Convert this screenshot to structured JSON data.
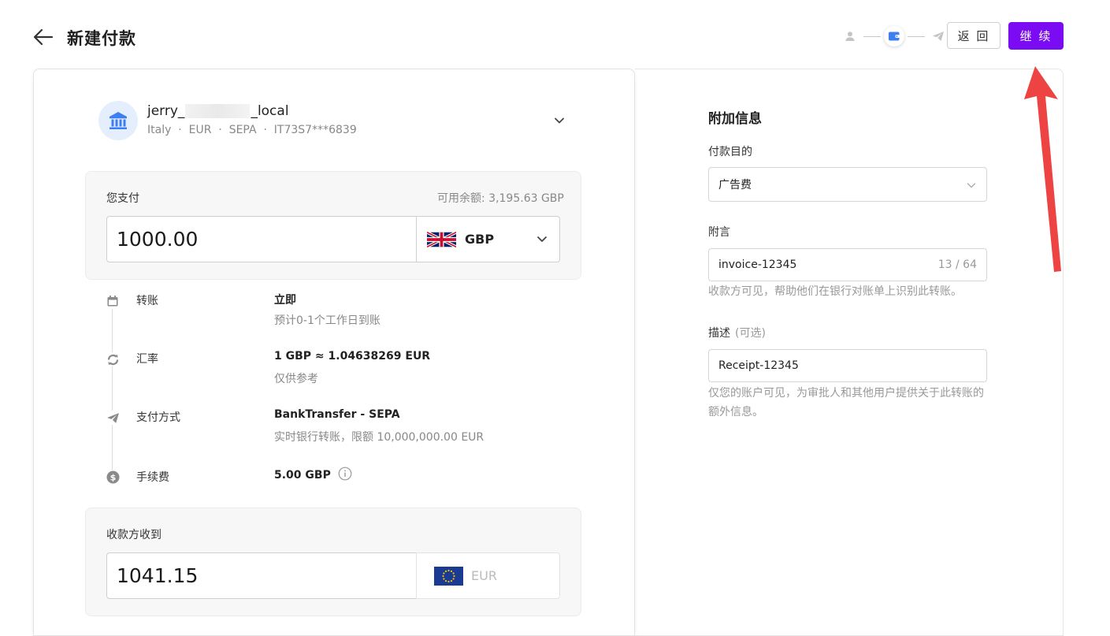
{
  "header": {
    "title": "新建付款",
    "back_button": "返 回",
    "continue_button": "继 续"
  },
  "stepper": {
    "steps": [
      "user-icon",
      "wallet-icon",
      "send-icon"
    ],
    "current": 1
  },
  "recipient": {
    "name_prefix": "jerry_",
    "name_suffix": "_local",
    "meta": "Italy  ·  EUR  ·  SEPA  ·  IT73S7***6839"
  },
  "pay": {
    "label": "您支付",
    "balance": "可用余额: 3,195.63 GBP",
    "amount": "1000.00",
    "currency": "GBP"
  },
  "details": [
    {
      "label": "转账",
      "value": "立即",
      "sub": "预计0-1个工作日到账",
      "icon": "calendar-icon"
    },
    {
      "label": "汇率",
      "value": "1 GBP ≈ 1.04638269 EUR",
      "sub": "仅供参考",
      "icon": "exchange-icon"
    },
    {
      "label": "支付方式",
      "value": "BankTransfer - SEPA",
      "sub": "实时银行转账，限额 10,000,000.00 EUR",
      "icon": "send-icon"
    },
    {
      "label": "手续费",
      "value": "5.00 GBP",
      "sub": "",
      "icon": "dollar-coin-icon"
    }
  ],
  "receive": {
    "label": "收款方收到",
    "amount": "1041.15",
    "currency": "EUR"
  },
  "additional": {
    "title": "附加信息",
    "purpose_label": "付款目的",
    "purpose_value": "广告费",
    "memo_label": "附言",
    "memo_value": "invoice-12345",
    "memo_counter": "13 / 64",
    "memo_help": "收款方可见，帮助他们在银行对账单上识别此转账。",
    "description_label": "描述",
    "description_optional": "(可选)",
    "description_value": "Receipt-12345",
    "description_help": "仅您的账户可见，为审批人和其他用户提供关于此转账的额外信息。"
  },
  "colors": {
    "accent": "#7a0bf3",
    "annotation_arrow": "#ee4343"
  }
}
